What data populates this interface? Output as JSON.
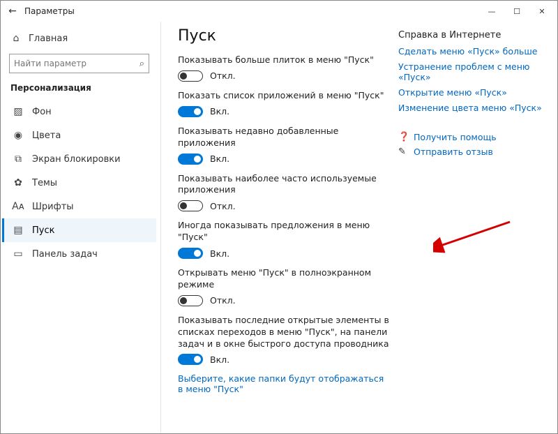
{
  "window_title": "Параметры",
  "home_label": "Главная",
  "search_placeholder": "Найти параметр",
  "section": "Персонализация",
  "nav": [
    {
      "label": "Фон"
    },
    {
      "label": "Цвета"
    },
    {
      "label": "Экран блокировки"
    },
    {
      "label": "Темы"
    },
    {
      "label": "Шрифты"
    },
    {
      "label": "Пуск"
    },
    {
      "label": "Панель задач"
    }
  ],
  "page_title": "Пуск",
  "settings": [
    {
      "label": "Показывать больше плиток в меню \"Пуск\"",
      "on": false,
      "state": "Откл."
    },
    {
      "label": "Показать список приложений в меню \"Пуск\"",
      "on": true,
      "state": "Вкл."
    },
    {
      "label": "Показывать недавно добавленные приложения",
      "on": true,
      "state": "Вкл."
    },
    {
      "label": "Показывать наиболее часто используемые приложения",
      "on": false,
      "state": "Откл."
    },
    {
      "label": "Иногда показывать предложения в меню \"Пуск\"",
      "on": true,
      "state": "Вкл."
    },
    {
      "label": "Открывать меню \"Пуск\" в полноэкранном режиме",
      "on": false,
      "state": "Откл."
    },
    {
      "label": "Показывать последние открытые элементы в списках переходов в меню \"Пуск\", на панели задач и в окне быстрого доступа проводника",
      "on": true,
      "state": "Вкл."
    }
  ],
  "folders_link": "Выберите, какие папки будут отображаться в меню \"Пуск\"",
  "help_heading": "Справка в Интернете",
  "help_links": [
    "Сделать меню «Пуск» больше",
    "Устранение проблем с меню «Пуск»",
    "Открытие меню «Пуск»",
    "Изменение цвета меню «Пуск»"
  ],
  "support": [
    {
      "label": "Получить помощь"
    },
    {
      "label": "Отправить отзыв"
    }
  ]
}
